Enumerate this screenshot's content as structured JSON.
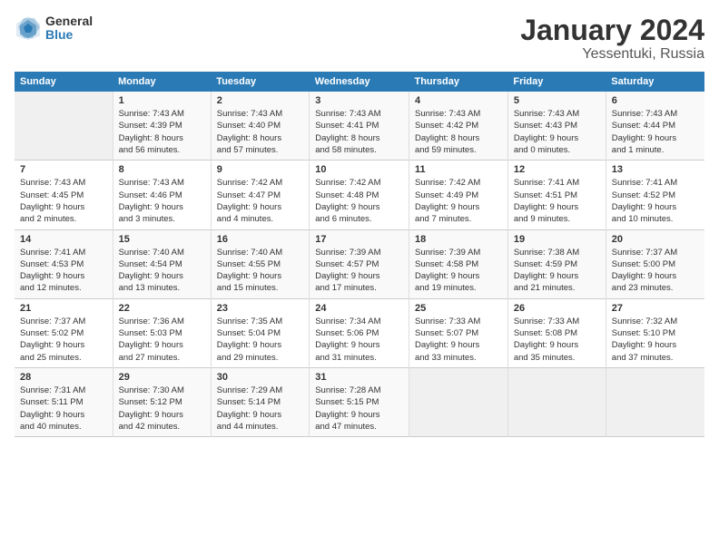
{
  "logo": {
    "general": "General",
    "blue": "Blue"
  },
  "title": "January 2024",
  "location": "Yessentuki, Russia",
  "days_header": [
    "Sunday",
    "Monday",
    "Tuesday",
    "Wednesday",
    "Thursday",
    "Friday",
    "Saturday"
  ],
  "weeks": [
    [
      {
        "num": "",
        "info": ""
      },
      {
        "num": "1",
        "info": "Sunrise: 7:43 AM\nSunset: 4:39 PM\nDaylight: 8 hours\nand 56 minutes."
      },
      {
        "num": "2",
        "info": "Sunrise: 7:43 AM\nSunset: 4:40 PM\nDaylight: 8 hours\nand 57 minutes."
      },
      {
        "num": "3",
        "info": "Sunrise: 7:43 AM\nSunset: 4:41 PM\nDaylight: 8 hours\nand 58 minutes."
      },
      {
        "num": "4",
        "info": "Sunrise: 7:43 AM\nSunset: 4:42 PM\nDaylight: 8 hours\nand 59 minutes."
      },
      {
        "num": "5",
        "info": "Sunrise: 7:43 AM\nSunset: 4:43 PM\nDaylight: 9 hours\nand 0 minutes."
      },
      {
        "num": "6",
        "info": "Sunrise: 7:43 AM\nSunset: 4:44 PM\nDaylight: 9 hours\nand 1 minute."
      }
    ],
    [
      {
        "num": "7",
        "info": "Sunrise: 7:43 AM\nSunset: 4:45 PM\nDaylight: 9 hours\nand 2 minutes."
      },
      {
        "num": "8",
        "info": "Sunrise: 7:43 AM\nSunset: 4:46 PM\nDaylight: 9 hours\nand 3 minutes."
      },
      {
        "num": "9",
        "info": "Sunrise: 7:42 AM\nSunset: 4:47 PM\nDaylight: 9 hours\nand 4 minutes."
      },
      {
        "num": "10",
        "info": "Sunrise: 7:42 AM\nSunset: 4:48 PM\nDaylight: 9 hours\nand 6 minutes."
      },
      {
        "num": "11",
        "info": "Sunrise: 7:42 AM\nSunset: 4:49 PM\nDaylight: 9 hours\nand 7 minutes."
      },
      {
        "num": "12",
        "info": "Sunrise: 7:41 AM\nSunset: 4:51 PM\nDaylight: 9 hours\nand 9 minutes."
      },
      {
        "num": "13",
        "info": "Sunrise: 7:41 AM\nSunset: 4:52 PM\nDaylight: 9 hours\nand 10 minutes."
      }
    ],
    [
      {
        "num": "14",
        "info": "Sunrise: 7:41 AM\nSunset: 4:53 PM\nDaylight: 9 hours\nand 12 minutes."
      },
      {
        "num": "15",
        "info": "Sunrise: 7:40 AM\nSunset: 4:54 PM\nDaylight: 9 hours\nand 13 minutes."
      },
      {
        "num": "16",
        "info": "Sunrise: 7:40 AM\nSunset: 4:55 PM\nDaylight: 9 hours\nand 15 minutes."
      },
      {
        "num": "17",
        "info": "Sunrise: 7:39 AM\nSunset: 4:57 PM\nDaylight: 9 hours\nand 17 minutes."
      },
      {
        "num": "18",
        "info": "Sunrise: 7:39 AM\nSunset: 4:58 PM\nDaylight: 9 hours\nand 19 minutes."
      },
      {
        "num": "19",
        "info": "Sunrise: 7:38 AM\nSunset: 4:59 PM\nDaylight: 9 hours\nand 21 minutes."
      },
      {
        "num": "20",
        "info": "Sunrise: 7:37 AM\nSunset: 5:00 PM\nDaylight: 9 hours\nand 23 minutes."
      }
    ],
    [
      {
        "num": "21",
        "info": "Sunrise: 7:37 AM\nSunset: 5:02 PM\nDaylight: 9 hours\nand 25 minutes."
      },
      {
        "num": "22",
        "info": "Sunrise: 7:36 AM\nSunset: 5:03 PM\nDaylight: 9 hours\nand 27 minutes."
      },
      {
        "num": "23",
        "info": "Sunrise: 7:35 AM\nSunset: 5:04 PM\nDaylight: 9 hours\nand 29 minutes."
      },
      {
        "num": "24",
        "info": "Sunrise: 7:34 AM\nSunset: 5:06 PM\nDaylight: 9 hours\nand 31 minutes."
      },
      {
        "num": "25",
        "info": "Sunrise: 7:33 AM\nSunset: 5:07 PM\nDaylight: 9 hours\nand 33 minutes."
      },
      {
        "num": "26",
        "info": "Sunrise: 7:33 AM\nSunset: 5:08 PM\nDaylight: 9 hours\nand 35 minutes."
      },
      {
        "num": "27",
        "info": "Sunrise: 7:32 AM\nSunset: 5:10 PM\nDaylight: 9 hours\nand 37 minutes."
      }
    ],
    [
      {
        "num": "28",
        "info": "Sunrise: 7:31 AM\nSunset: 5:11 PM\nDaylight: 9 hours\nand 40 minutes."
      },
      {
        "num": "29",
        "info": "Sunrise: 7:30 AM\nSunset: 5:12 PM\nDaylight: 9 hours\nand 42 minutes."
      },
      {
        "num": "30",
        "info": "Sunrise: 7:29 AM\nSunset: 5:14 PM\nDaylight: 9 hours\nand 44 minutes."
      },
      {
        "num": "31",
        "info": "Sunrise: 7:28 AM\nSunset: 5:15 PM\nDaylight: 9 hours\nand 47 minutes."
      },
      {
        "num": "",
        "info": ""
      },
      {
        "num": "",
        "info": ""
      },
      {
        "num": "",
        "info": ""
      }
    ]
  ]
}
